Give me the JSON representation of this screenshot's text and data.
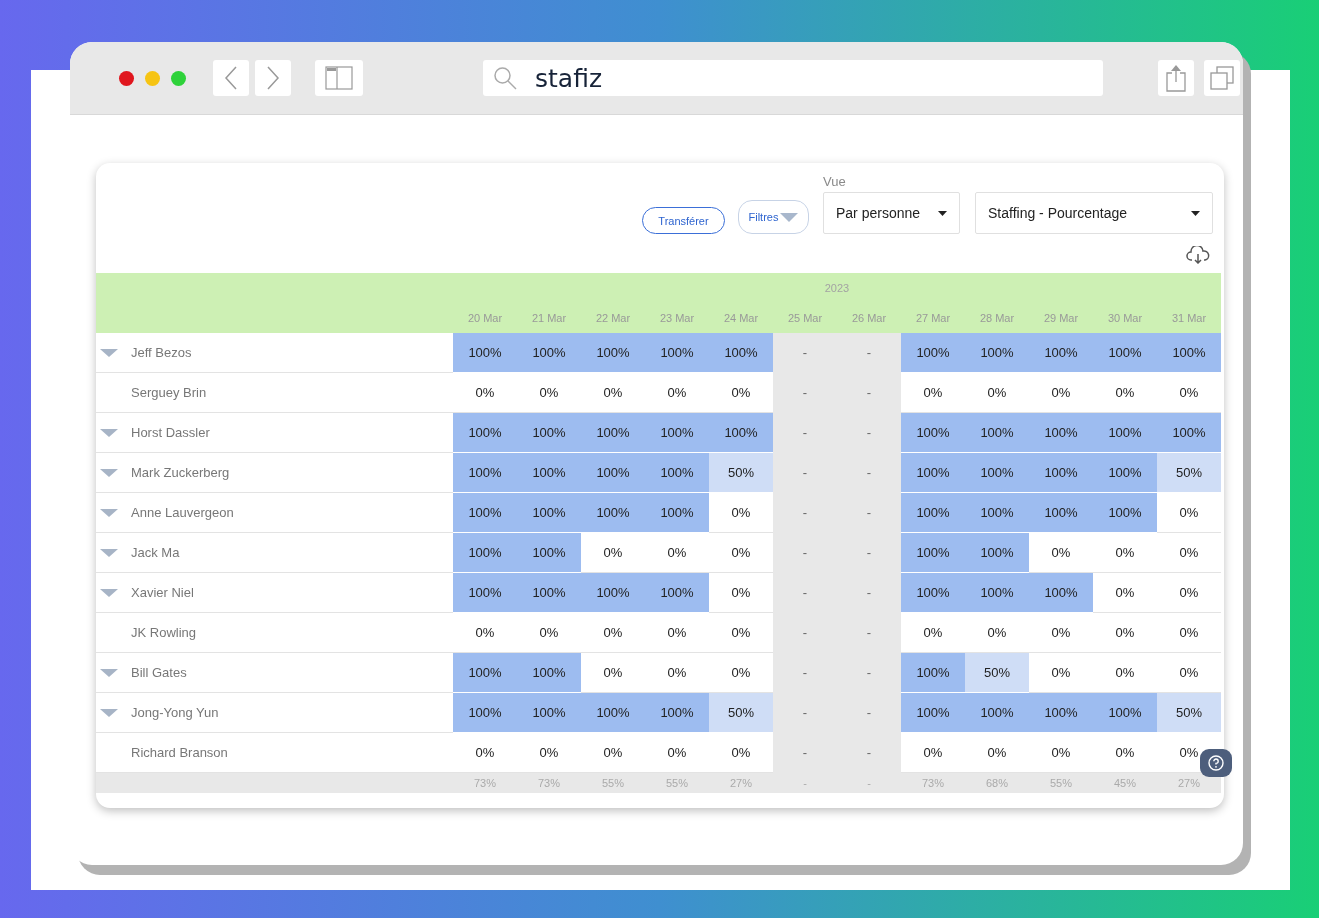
{
  "browser": {
    "address": "stafiz"
  },
  "toolbar": {
    "transfer_button": "Transférer",
    "filter_button": "Filtres",
    "view_label": "Vue",
    "view_select": "Par personne",
    "mode_select": "Staffing - Pourcentage"
  },
  "table": {
    "year": "2023",
    "dates": [
      "20 Mar",
      "21 Mar",
      "22 Mar",
      "23 Mar",
      "24 Mar",
      "25 Mar",
      "26 Mar",
      "27 Mar",
      "28 Mar",
      "29 Mar",
      "30 Mar",
      "31 Mar"
    ],
    "rows": [
      {
        "name": "Jeff Bezos",
        "expandable": true,
        "cells": [
          {
            "value": "100%",
            "kind": "full"
          },
          {
            "value": "100%",
            "kind": "full"
          },
          {
            "value": "100%",
            "kind": "full"
          },
          {
            "value": "100%",
            "kind": "full"
          },
          {
            "value": "100%",
            "kind": "full"
          },
          {
            "value": "-",
            "kind": "off"
          },
          {
            "value": "-",
            "kind": "off"
          },
          {
            "value": "100%",
            "kind": "full"
          },
          {
            "value": "100%",
            "kind": "full"
          },
          {
            "value": "100%",
            "kind": "full"
          },
          {
            "value": "100%",
            "kind": "full"
          },
          {
            "value": "100%",
            "kind": "full"
          }
        ]
      },
      {
        "name": "Serguey Brin",
        "expandable": false,
        "cells": [
          {
            "value": "0%",
            "kind": "empty"
          },
          {
            "value": "0%",
            "kind": "empty"
          },
          {
            "value": "0%",
            "kind": "empty"
          },
          {
            "value": "0%",
            "kind": "empty"
          },
          {
            "value": "0%",
            "kind": "empty"
          },
          {
            "value": "-",
            "kind": "off"
          },
          {
            "value": "-",
            "kind": "off"
          },
          {
            "value": "0%",
            "kind": "empty"
          },
          {
            "value": "0%",
            "kind": "empty"
          },
          {
            "value": "0%",
            "kind": "empty"
          },
          {
            "value": "0%",
            "kind": "empty"
          },
          {
            "value": "0%",
            "kind": "empty"
          }
        ]
      },
      {
        "name": "Horst Dassler",
        "expandable": true,
        "cells": [
          {
            "value": "100%",
            "kind": "full"
          },
          {
            "value": "100%",
            "kind": "full"
          },
          {
            "value": "100%",
            "kind": "full"
          },
          {
            "value": "100%",
            "kind": "full"
          },
          {
            "value": "100%",
            "kind": "full"
          },
          {
            "value": "-",
            "kind": "off"
          },
          {
            "value": "-",
            "kind": "off"
          },
          {
            "value": "100%",
            "kind": "full"
          },
          {
            "value": "100%",
            "kind": "full"
          },
          {
            "value": "100%",
            "kind": "full"
          },
          {
            "value": "100%",
            "kind": "full"
          },
          {
            "value": "100%",
            "kind": "full"
          }
        ]
      },
      {
        "name": "Mark Zuckerberg",
        "expandable": true,
        "cells": [
          {
            "value": "100%",
            "kind": "full"
          },
          {
            "value": "100%",
            "kind": "full"
          },
          {
            "value": "100%",
            "kind": "full"
          },
          {
            "value": "100%",
            "kind": "full"
          },
          {
            "value": "50%",
            "kind": "partial"
          },
          {
            "value": "-",
            "kind": "off"
          },
          {
            "value": "-",
            "kind": "off"
          },
          {
            "value": "100%",
            "kind": "full"
          },
          {
            "value": "100%",
            "kind": "full"
          },
          {
            "value": "100%",
            "kind": "full"
          },
          {
            "value": "100%",
            "kind": "full"
          },
          {
            "value": "50%",
            "kind": "partial"
          }
        ]
      },
      {
        "name": "Anne Lauvergeon",
        "expandable": true,
        "cells": [
          {
            "value": "100%",
            "kind": "full"
          },
          {
            "value": "100%",
            "kind": "full"
          },
          {
            "value": "100%",
            "kind": "full"
          },
          {
            "value": "100%",
            "kind": "full"
          },
          {
            "value": "0%",
            "kind": "empty"
          },
          {
            "value": "-",
            "kind": "off"
          },
          {
            "value": "-",
            "kind": "off"
          },
          {
            "value": "100%",
            "kind": "full"
          },
          {
            "value": "100%",
            "kind": "full"
          },
          {
            "value": "100%",
            "kind": "full"
          },
          {
            "value": "100%",
            "kind": "full"
          },
          {
            "value": "0%",
            "kind": "empty"
          }
        ]
      },
      {
        "name": "Jack Ma",
        "expandable": true,
        "cells": [
          {
            "value": "100%",
            "kind": "full"
          },
          {
            "value": "100%",
            "kind": "full"
          },
          {
            "value": "0%",
            "kind": "empty"
          },
          {
            "value": "0%",
            "kind": "empty"
          },
          {
            "value": "0%",
            "kind": "empty"
          },
          {
            "value": "-",
            "kind": "off"
          },
          {
            "value": "-",
            "kind": "off"
          },
          {
            "value": "100%",
            "kind": "full"
          },
          {
            "value": "100%",
            "kind": "full"
          },
          {
            "value": "0%",
            "kind": "empty"
          },
          {
            "value": "0%",
            "kind": "empty"
          },
          {
            "value": "0%",
            "kind": "empty"
          }
        ]
      },
      {
        "name": "Xavier Niel",
        "expandable": true,
        "cells": [
          {
            "value": "100%",
            "kind": "full"
          },
          {
            "value": "100%",
            "kind": "full"
          },
          {
            "value": "100%",
            "kind": "full"
          },
          {
            "value": "100%",
            "kind": "full"
          },
          {
            "value": "0%",
            "kind": "empty"
          },
          {
            "value": "-",
            "kind": "off"
          },
          {
            "value": "-",
            "kind": "off"
          },
          {
            "value": "100%",
            "kind": "full"
          },
          {
            "value": "100%",
            "kind": "full"
          },
          {
            "value": "100%",
            "kind": "full"
          },
          {
            "value": "0%",
            "kind": "empty"
          },
          {
            "value": "0%",
            "kind": "empty"
          }
        ]
      },
      {
        "name": "JK Rowling",
        "expandable": false,
        "cells": [
          {
            "value": "0%",
            "kind": "empty"
          },
          {
            "value": "0%",
            "kind": "empty"
          },
          {
            "value": "0%",
            "kind": "empty"
          },
          {
            "value": "0%",
            "kind": "empty"
          },
          {
            "value": "0%",
            "kind": "empty"
          },
          {
            "value": "-",
            "kind": "off"
          },
          {
            "value": "-",
            "kind": "off"
          },
          {
            "value": "0%",
            "kind": "empty"
          },
          {
            "value": "0%",
            "kind": "empty"
          },
          {
            "value": "0%",
            "kind": "empty"
          },
          {
            "value": "0%",
            "kind": "empty"
          },
          {
            "value": "0%",
            "kind": "empty"
          }
        ]
      },
      {
        "name": "Bill Gates",
        "expandable": true,
        "cells": [
          {
            "value": "100%",
            "kind": "full"
          },
          {
            "value": "100%",
            "kind": "full"
          },
          {
            "value": "0%",
            "kind": "empty"
          },
          {
            "value": "0%",
            "kind": "empty"
          },
          {
            "value": "0%",
            "kind": "empty"
          },
          {
            "value": "-",
            "kind": "off"
          },
          {
            "value": "-",
            "kind": "off"
          },
          {
            "value": "100%",
            "kind": "full"
          },
          {
            "value": "50%",
            "kind": "partial"
          },
          {
            "value": "0%",
            "kind": "empty"
          },
          {
            "value": "0%",
            "kind": "empty"
          },
          {
            "value": "0%",
            "kind": "empty"
          }
        ]
      },
      {
        "name": "Jong-Yong Yun",
        "expandable": true,
        "cells": [
          {
            "value": "100%",
            "kind": "full"
          },
          {
            "value": "100%",
            "kind": "full"
          },
          {
            "value": "100%",
            "kind": "full"
          },
          {
            "value": "100%",
            "kind": "full"
          },
          {
            "value": "50%",
            "kind": "partial"
          },
          {
            "value": "-",
            "kind": "off"
          },
          {
            "value": "-",
            "kind": "off"
          },
          {
            "value": "100%",
            "kind": "full"
          },
          {
            "value": "100%",
            "kind": "full"
          },
          {
            "value": "100%",
            "kind": "full"
          },
          {
            "value": "100%",
            "kind": "full"
          },
          {
            "value": "50%",
            "kind": "partial"
          }
        ]
      },
      {
        "name": "Richard Branson",
        "expandable": false,
        "cells": [
          {
            "value": "0%",
            "kind": "empty"
          },
          {
            "value": "0%",
            "kind": "empty"
          },
          {
            "value": "0%",
            "kind": "empty"
          },
          {
            "value": "0%",
            "kind": "empty"
          },
          {
            "value": "0%",
            "kind": "empty"
          },
          {
            "value": "-",
            "kind": "off"
          },
          {
            "value": "-",
            "kind": "off"
          },
          {
            "value": "0%",
            "kind": "empty"
          },
          {
            "value": "0%",
            "kind": "empty"
          },
          {
            "value": "0%",
            "kind": "empty"
          },
          {
            "value": "0%",
            "kind": "empty"
          },
          {
            "value": "0%",
            "kind": "empty"
          }
        ]
      }
    ],
    "totals": [
      "73%",
      "73%",
      "55%",
      "55%",
      "27%",
      "-",
      "-",
      "73%",
      "68%",
      "55%",
      "45%",
      "27%"
    ]
  }
}
